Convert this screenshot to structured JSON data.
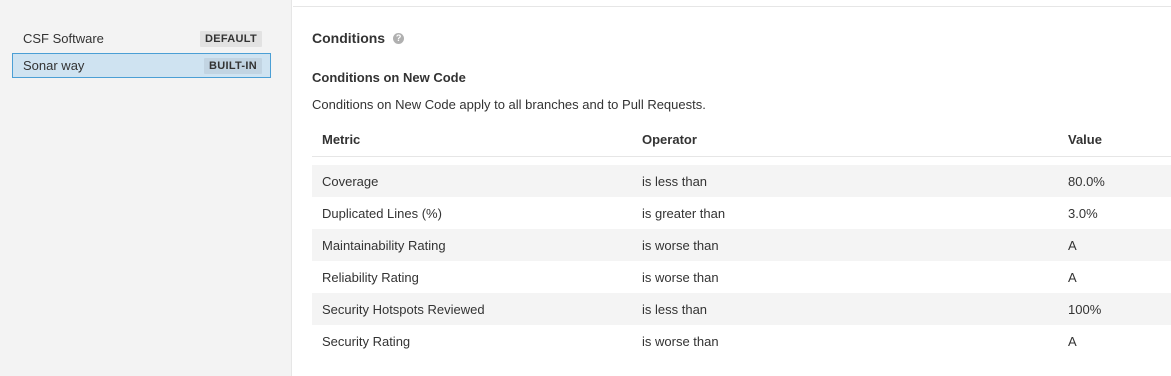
{
  "sidebar": {
    "gates": [
      {
        "name": "CSF Software",
        "badge": "DEFAULT"
      },
      {
        "name": "Sonar way",
        "badge": "BUILT-IN"
      }
    ]
  },
  "main": {
    "section_title": "Conditions",
    "help_icon": "?",
    "sub_title": "Conditions on New Code",
    "description": "Conditions on New Code apply to all branches and to Pull Requests.",
    "table": {
      "headers": {
        "metric": "Metric",
        "operator": "Operator",
        "value": "Value"
      },
      "rows": [
        {
          "metric": "Coverage",
          "operator": "is less than",
          "value": "80.0%"
        },
        {
          "metric": "Duplicated Lines (%)",
          "operator": "is greater than",
          "value": "3.0%"
        },
        {
          "metric": "Maintainability Rating",
          "operator": "is worse than",
          "value": "A"
        },
        {
          "metric": "Reliability Rating",
          "operator": "is worse than",
          "value": "A"
        },
        {
          "metric": "Security Hotspots Reviewed",
          "operator": "is less than",
          "value": "100%"
        },
        {
          "metric": "Security Rating",
          "operator": "is worse than",
          "value": "A"
        }
      ]
    }
  },
  "colors": {
    "selected_bg": "#cfe3f1",
    "selected_border": "#4b9fd5",
    "sidebar_bg": "#f3f3f3",
    "stripe_bg": "#f4f4f4"
  }
}
